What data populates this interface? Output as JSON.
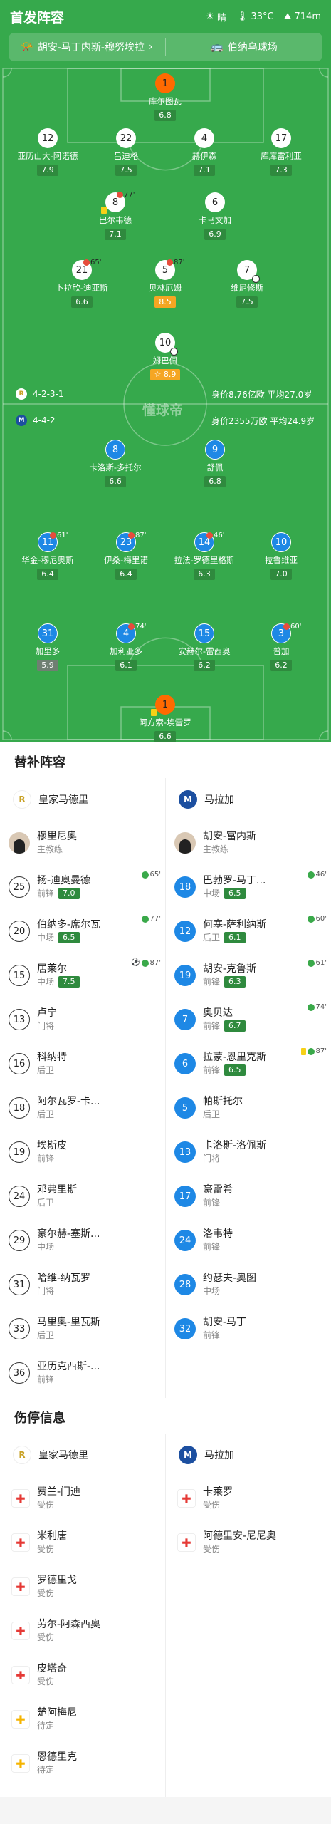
{
  "header": {
    "title": "首发阵容",
    "weather_label": "晴",
    "temp": "33°C",
    "altitude": "714m"
  },
  "match": {
    "teams": "胡安-马丁内斯-穆努埃拉",
    "stadium": "伯纳乌球场"
  },
  "watermark": "懂球帝",
  "home": {
    "formation": "4-2-3-1",
    "value": "身价8.76亿欧  平均27.0岁",
    "name": "皇家马德里"
  },
  "away": {
    "formation": "4-4-2",
    "value": "身价2355万欧  平均24.9岁",
    "name": "马拉加"
  },
  "pitch_players": [
    {
      "num": "1",
      "name": "库尔图瓦",
      "rating": "6.8",
      "style": "o"
    },
    {
      "num": "12",
      "name": "亚历山大-阿诺德",
      "rating": "7.9",
      "style": "w"
    },
    {
      "num": "22",
      "name": "吕迪格",
      "rating": "7.5",
      "style": "w"
    },
    {
      "num": "4",
      "name": "赫伊森",
      "rating": "7.1",
      "style": "w"
    },
    {
      "num": "17",
      "name": "库库雷利亚",
      "rating": "7.3",
      "style": "w"
    },
    {
      "num": "8",
      "name": "巴尔韦德",
      "rating": "7.1",
      "style": "w",
      "sub": "77'"
    },
    {
      "num": "6",
      "name": "卡马文加",
      "rating": "6.9",
      "style": "w"
    },
    {
      "num": "21",
      "name": "卜拉欣-迪亚斯",
      "rating": "6.6",
      "style": "w",
      "sub": "65'"
    },
    {
      "num": "5",
      "name": "贝林厄姆",
      "rating": "8.5",
      "style": "w",
      "sub": "87'",
      "gold": true
    },
    {
      "num": "7",
      "name": "维尼修斯",
      "rating": "7.5",
      "style": "w"
    },
    {
      "num": "10",
      "name": "姆巴佩",
      "rating": "8.9",
      "style": "w",
      "gold": true,
      "star": "☆ "
    },
    {
      "num": "8",
      "name": "卡洛斯-多托尔",
      "rating": "6.6",
      "style": "b"
    },
    {
      "num": "9",
      "name": "舒佩",
      "rating": "6.8",
      "style": "b"
    },
    {
      "num": "11",
      "name": "华金-穆尼奥斯",
      "rating": "6.4",
      "style": "b",
      "sub": "61'"
    },
    {
      "num": "23",
      "name": "伊桑-梅里诺",
      "rating": "6.4",
      "style": "b",
      "sub": "87'"
    },
    {
      "num": "14",
      "name": "拉法-罗德里格斯",
      "rating": "6.3",
      "style": "b",
      "sub": "46'"
    },
    {
      "num": "10",
      "name": "拉鲁维亚",
      "rating": "7.0",
      "style": "b"
    },
    {
      "num": "31",
      "name": "加里多",
      "rating": "5.9",
      "style": "b",
      "grey": true
    },
    {
      "num": "4",
      "name": "加利亚多",
      "rating": "6.1",
      "style": "b",
      "sub": "74'"
    },
    {
      "num": "15",
      "name": "安赫尔-雷西奥",
      "rating": "6.2",
      "style": "b"
    },
    {
      "num": "3",
      "name": "普加",
      "rating": "6.2",
      "style": "b",
      "sub": "60'"
    },
    {
      "num": "1",
      "name": "阿方索-埃雷罗",
      "rating": "6.6",
      "style": "o"
    }
  ],
  "subs": {
    "title": "替补阵容",
    "coach_label": "主教练",
    "home_coach": "穆里尼奥",
    "away_coach": "胡安-富内斯",
    "home": [
      {
        "num": "25",
        "name": "扬-迪奥曼德",
        "pos": "前锋",
        "rating": "7.0",
        "mark": "65'"
      },
      {
        "num": "20",
        "name": "伯纳多-席尔瓦",
        "pos": "中场",
        "rating": "6.5",
        "mark": "77'"
      },
      {
        "num": "15",
        "name": "居莱尔",
        "pos": "中场",
        "rating": "7.5",
        "mark": "87'",
        "ball": true
      },
      {
        "num": "13",
        "name": "卢宁",
        "pos": "门将"
      },
      {
        "num": "16",
        "name": "科纳特",
        "pos": "后卫"
      },
      {
        "num": "18",
        "name": "阿尔瓦罗-卡...",
        "pos": "后卫"
      },
      {
        "num": "19",
        "name": "埃斯皮",
        "pos": "前锋"
      },
      {
        "num": "24",
        "name": "邓弗里斯",
        "pos": "后卫"
      },
      {
        "num": "29",
        "name": "豪尔赫-塞斯...",
        "pos": "中场"
      },
      {
        "num": "31",
        "name": "哈维-纳瓦罗",
        "pos": "门将"
      },
      {
        "num": "33",
        "name": "马里奥-里瓦斯",
        "pos": "后卫"
      },
      {
        "num": "36",
        "name": "亚历克西斯-...",
        "pos": "前锋"
      }
    ],
    "away": [
      {
        "num": "18",
        "name": "巴勃罗-马丁...",
        "pos": "中场",
        "rating": "6.5",
        "mark": "46'"
      },
      {
        "num": "12",
        "name": "何塞-萨利纳斯",
        "pos": "后卫",
        "rating": "6.1",
        "mark": "60'"
      },
      {
        "num": "19",
        "name": "胡安-克鲁斯",
        "pos": "前锋",
        "rating": "6.3",
        "mark": "61'"
      },
      {
        "num": "7",
        "name": "奥贝达",
        "pos": "前锋",
        "rating": "6.7",
        "mark": "74'"
      },
      {
        "num": "6",
        "name": "拉蒙-恩里克斯",
        "pos": "前锋",
        "rating": "6.5",
        "mark": "87'",
        "ycard": true
      },
      {
        "num": "5",
        "name": "帕斯托尔",
        "pos": "后卫"
      },
      {
        "num": "13",
        "name": "卡洛斯-洛佩斯",
        "pos": "门将"
      },
      {
        "num": "17",
        "name": "豪雷希",
        "pos": "前锋"
      },
      {
        "num": "24",
        "name": "洛韦特",
        "pos": "前锋"
      },
      {
        "num": "28",
        "name": "约瑟夫-奥图",
        "pos": "中场"
      },
      {
        "num": "32",
        "name": "胡安-马丁",
        "pos": "前锋"
      }
    ]
  },
  "injuries": {
    "title": "伤停信息",
    "home": [
      {
        "name": "费兰-门迪",
        "status": "受伤"
      },
      {
        "name": "米利唐",
        "status": "受伤"
      },
      {
        "name": "罗德里戈",
        "status": "受伤"
      },
      {
        "name": "劳尔-阿森西奥",
        "status": "受伤"
      },
      {
        "name": "皮塔奇",
        "status": "受伤"
      },
      {
        "name": "楚阿梅尼",
        "status": "待定",
        "doubt": true
      },
      {
        "name": "恩德里克",
        "status": "待定",
        "doubt": true
      }
    ],
    "away": [
      {
        "name": "卡莱罗",
        "status": "受伤"
      },
      {
        "name": "阿德里安-尼尼奥",
        "status": "受伤"
      }
    ]
  }
}
